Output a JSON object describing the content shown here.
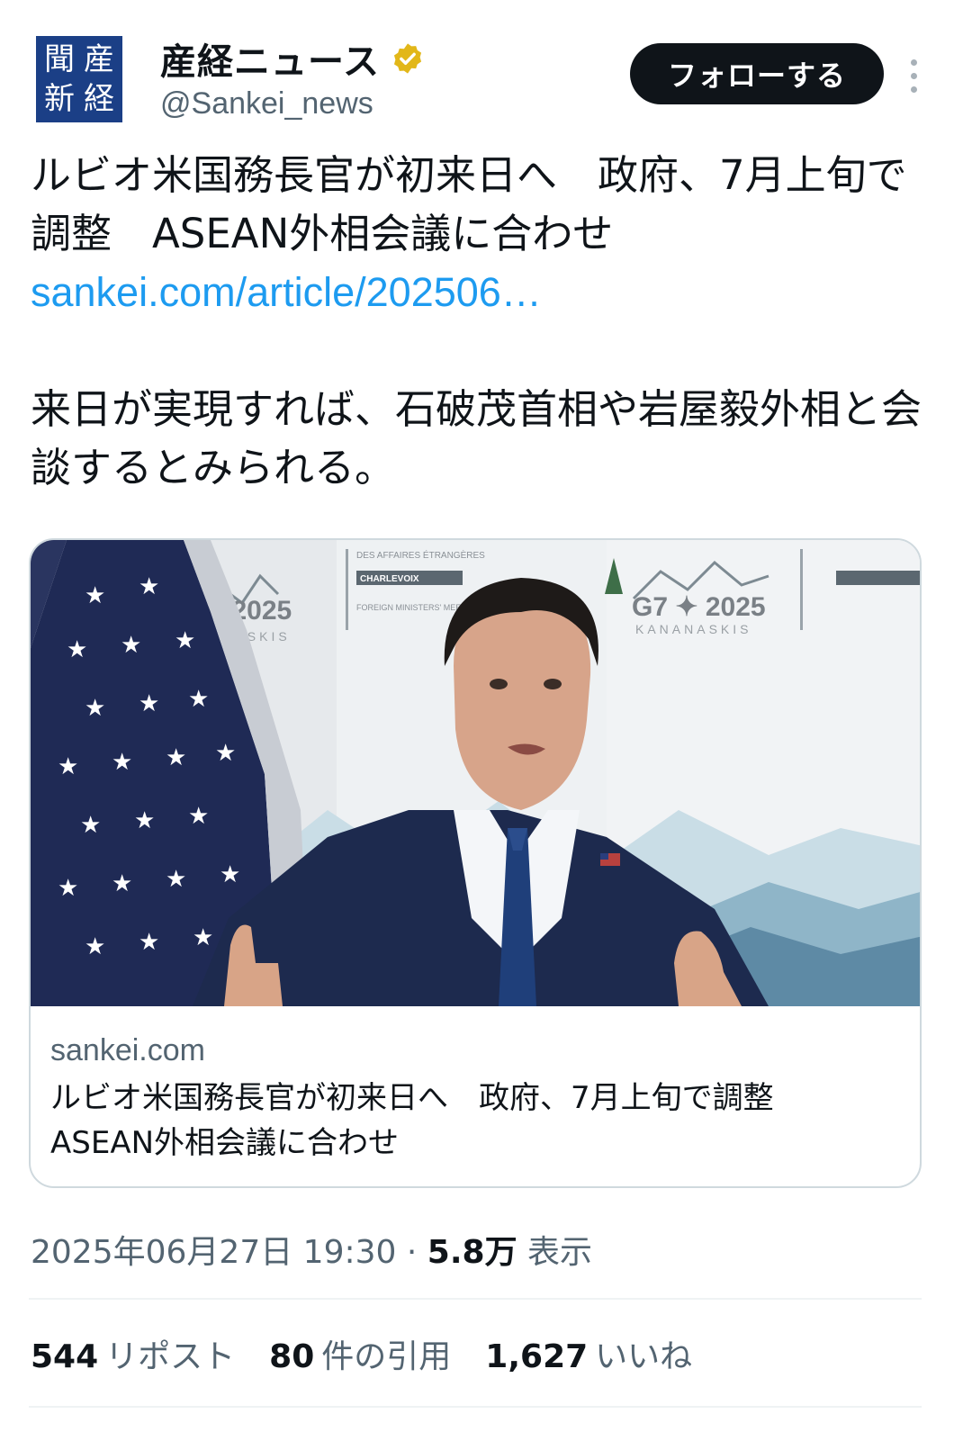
{
  "header": {
    "logo_chars": [
      "産",
      "経",
      "新",
      "聞"
    ],
    "name": "産経ニュース",
    "handle": "@Sankei_news",
    "follow_label": "フォローする"
  },
  "tweet": {
    "headline": "ルビオ米国務長官が初来日へ　政府、7月上旬で調整　ASEAN外相会議に合わせ",
    "link": "sankei.com/article/202506…",
    "body": "来日が実現すれば、石破茂首相や岩屋毅外相と会談するとみられる。"
  },
  "card": {
    "domain": "sankei.com",
    "title": "ルビオ米国務長官が初来日へ　政府、7月上旬で調整　ASEAN外相会議に合わせ",
    "image_text": {
      "left_logo": "✦ 2025",
      "left_sub": "ANASKIS",
      "right_logo": "G7 ✦ 2025",
      "right_sub": "KANANASKIS",
      "banner_1": "DES AFFAIRES ÉTRANGÈRES",
      "banner_2": "CHARLEVOIX",
      "banner_3": "FOREIGN MINISTERS' MEETING"
    }
  },
  "meta": {
    "timestamp": "2025年06月27日 19:30",
    "separator": "·",
    "views_count": "5.8万",
    "views_label": "表示"
  },
  "stats": {
    "reposts_count": "544",
    "reposts_label": "リポスト",
    "quotes_count": "80",
    "quotes_label": "件の引用",
    "likes_count": "1,627",
    "likes_label": "いいね"
  },
  "colors": {
    "link": "#1d9bf0",
    "verified": "#e2b719",
    "follow_bg": "#0f1419",
    "logo_bg": "#1b3f86"
  }
}
